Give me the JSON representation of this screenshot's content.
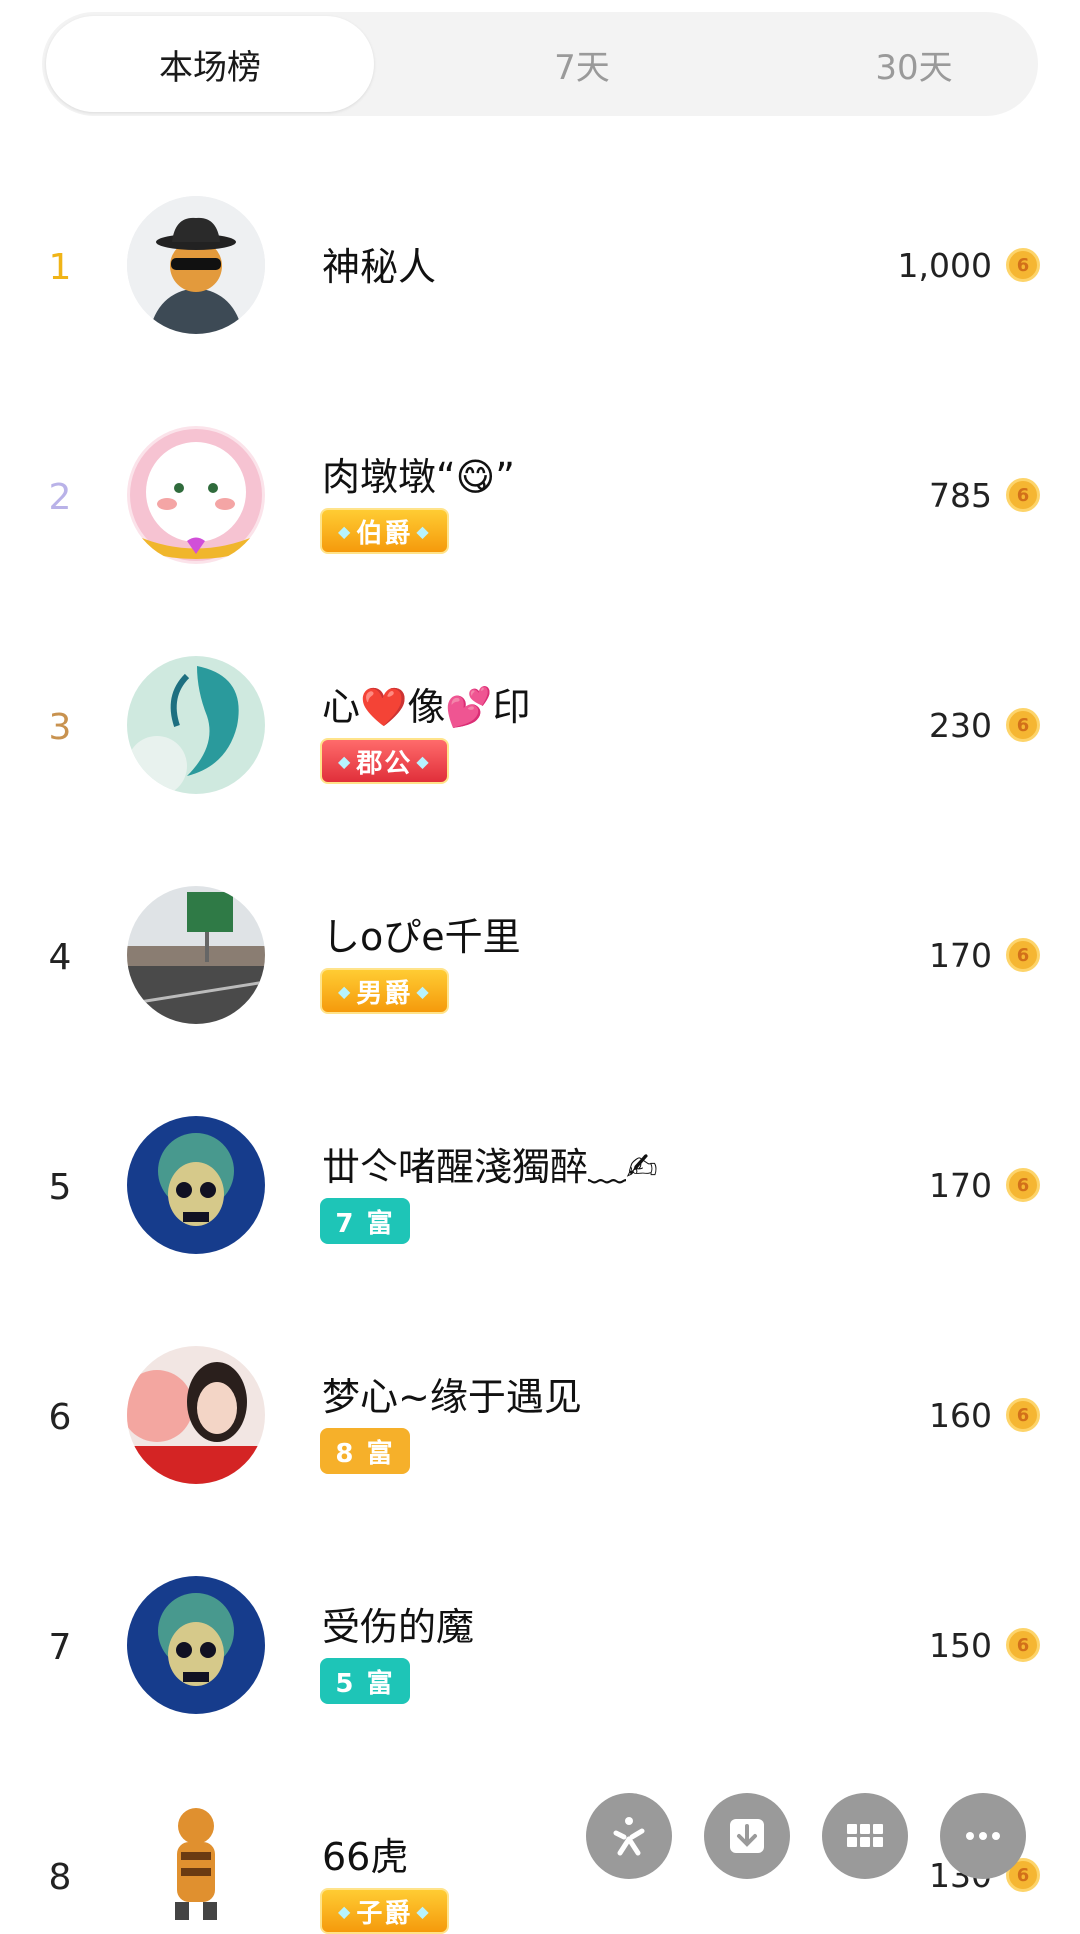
{
  "tabs": [
    {
      "label": "本场榜",
      "active": true
    },
    {
      "label": "7天",
      "active": false
    },
    {
      "label": "30天",
      "active": false
    }
  ],
  "coin_icon": {
    "name": "coin-icon",
    "glyph": "6"
  },
  "rows": [
    {
      "rank": "1",
      "name": "神秘人",
      "badge": "",
      "score": "1,000"
    },
    {
      "rank": "2",
      "name": "肉墩墩“😋”",
      "badge": "伯爵",
      "score": "785"
    },
    {
      "rank": "3",
      "name": "心❤️像💕印",
      "badge": "郡公",
      "score": "230"
    },
    {
      "rank": "4",
      "name": "しoぴe千里",
      "badge": "男爵",
      "score": "170"
    },
    {
      "rank": "5",
      "name": "丗仒啫醒淺獨醉﹏✍",
      "badge": "7 富",
      "score": "170"
    },
    {
      "rank": "6",
      "name": "梦心~缘于遇见",
      "badge": "8 富",
      "score": "160"
    },
    {
      "rank": "7",
      "name": "受伤的魔",
      "badge": "5 富",
      "score": "150"
    },
    {
      "rank": "8",
      "name": "66虎",
      "badge": "子爵",
      "score": "130"
    }
  ],
  "fab_icons": [
    "kuaikan-logo-icon",
    "download-icon",
    "grid-icon",
    "more-icon"
  ],
  "colors": {
    "rank1": "#f0b417",
    "rank2": "#b9b2e8",
    "rank3": "#c8924f",
    "badge_gold": "#f59a0c",
    "badge_red": "#e02f3a",
    "badge_teal": "#1ec5b7",
    "badge_orange": "#f6b02a",
    "fab_gray": "#9a9a9a"
  }
}
